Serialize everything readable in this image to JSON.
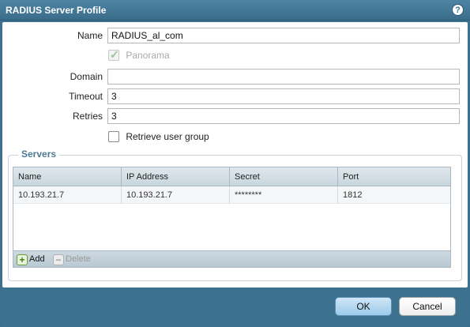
{
  "dialog": {
    "title": "RADIUS Server Profile",
    "help_icon": "help-icon"
  },
  "form": {
    "name_label": "Name",
    "name_value": "RADIUS_al_com",
    "panorama_label": "Panorama",
    "panorama_checked": true,
    "panorama_disabled": true,
    "domain_label": "Domain",
    "domain_value": "",
    "timeout_label": "Timeout",
    "timeout_value": "3",
    "retries_label": "Retries",
    "retries_value": "3",
    "retrieve_group_label": "Retrieve user group",
    "retrieve_group_checked": false
  },
  "servers": {
    "legend": "Servers",
    "columns": [
      "Name",
      "IP Address",
      "Secret",
      "Port"
    ],
    "rows": [
      [
        "10.193.21.7",
        "10.193.21.7",
        "********",
        "1812"
      ]
    ],
    "add_label": "Add",
    "delete_label": "Delete"
  },
  "buttons": {
    "ok_label": "OK",
    "cancel_label": "Cancel"
  },
  "colors": {
    "title_bar": "#3d7190",
    "accent": "#4d7a95"
  }
}
